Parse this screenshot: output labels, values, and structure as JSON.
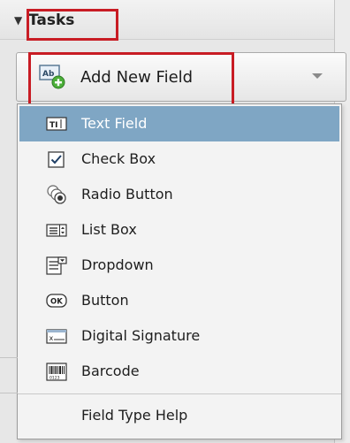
{
  "tasks": {
    "title": "Tasks"
  },
  "add_field": {
    "label": "Add New Field"
  },
  "menu": {
    "items": [
      {
        "label": "Text Field",
        "icon": "text-field-icon",
        "selected": true
      },
      {
        "label": "Check Box",
        "icon": "checkbox-icon"
      },
      {
        "label": "Radio Button",
        "icon": "radio-button-icon"
      },
      {
        "label": "List Box",
        "icon": "list-box-icon"
      },
      {
        "label": "Dropdown",
        "icon": "dropdown-icon"
      },
      {
        "label": "Button",
        "icon": "button-icon"
      },
      {
        "label": "Digital Signature",
        "icon": "digital-signature-icon"
      },
      {
        "label": "Barcode",
        "icon": "barcode-icon"
      }
    ],
    "help_label": "Field Type Help"
  },
  "colors": {
    "highlight_box": "#c81c24",
    "selected_item": "#7fa6c4"
  }
}
